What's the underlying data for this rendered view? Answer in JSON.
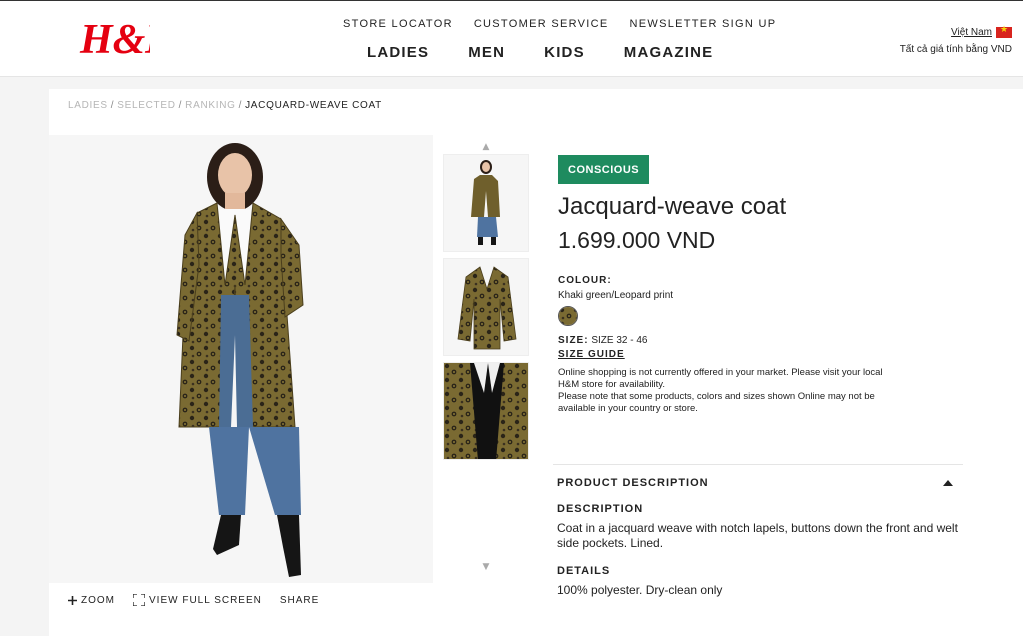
{
  "header": {
    "logo_text": "H&M",
    "util_links": [
      "STORE LOCATOR",
      "CUSTOMER SERVICE",
      "NEWSLETTER SIGN UP"
    ],
    "main_nav": [
      "LADIES",
      "MEN",
      "KIDS",
      "MAGAZINE"
    ],
    "country": "Việt Nam",
    "currency_note": "Tất cả giá tính bằng VND"
  },
  "breadcrumb": {
    "links": [
      "LADIES",
      "SELECTED",
      "RANKING"
    ],
    "current": "JACQUARD-WEAVE COAT"
  },
  "image_tools": {
    "zoom": "ZOOM",
    "full_screen": "VIEW FULL SCREEN",
    "share": "SHARE"
  },
  "product": {
    "badge": "CONSCIOUS",
    "title": "Jacquard-weave coat",
    "price": "1.699.000 VND",
    "colour_label": "COLOUR:",
    "colour_name": "Khaki green/Leopard print",
    "size_label": "SIZE:",
    "size_value": "SIZE 32 - 46",
    "size_guide": "SIZE GUIDE",
    "notice_line1": "Online shopping is not currently offered in your market. Please visit your local H&M store for availability.",
    "notice_line2": "Please note that some products, colors and sizes shown Online may not be available in your country or store."
  },
  "description": {
    "section_title": "PRODUCT DESCRIPTION",
    "description_label": "DESCRIPTION",
    "description_text": "Coat in a jacquard weave with notch lapels, buttons down the front and welt side pockets. Lined.",
    "details_label": "DETAILS",
    "details_text": "100% polyester. Dry-clean only"
  },
  "colors": {
    "brand_red": "#e50010",
    "conscious_green": "#1e8b5f",
    "coat_khaki": "#6b5a2a"
  }
}
